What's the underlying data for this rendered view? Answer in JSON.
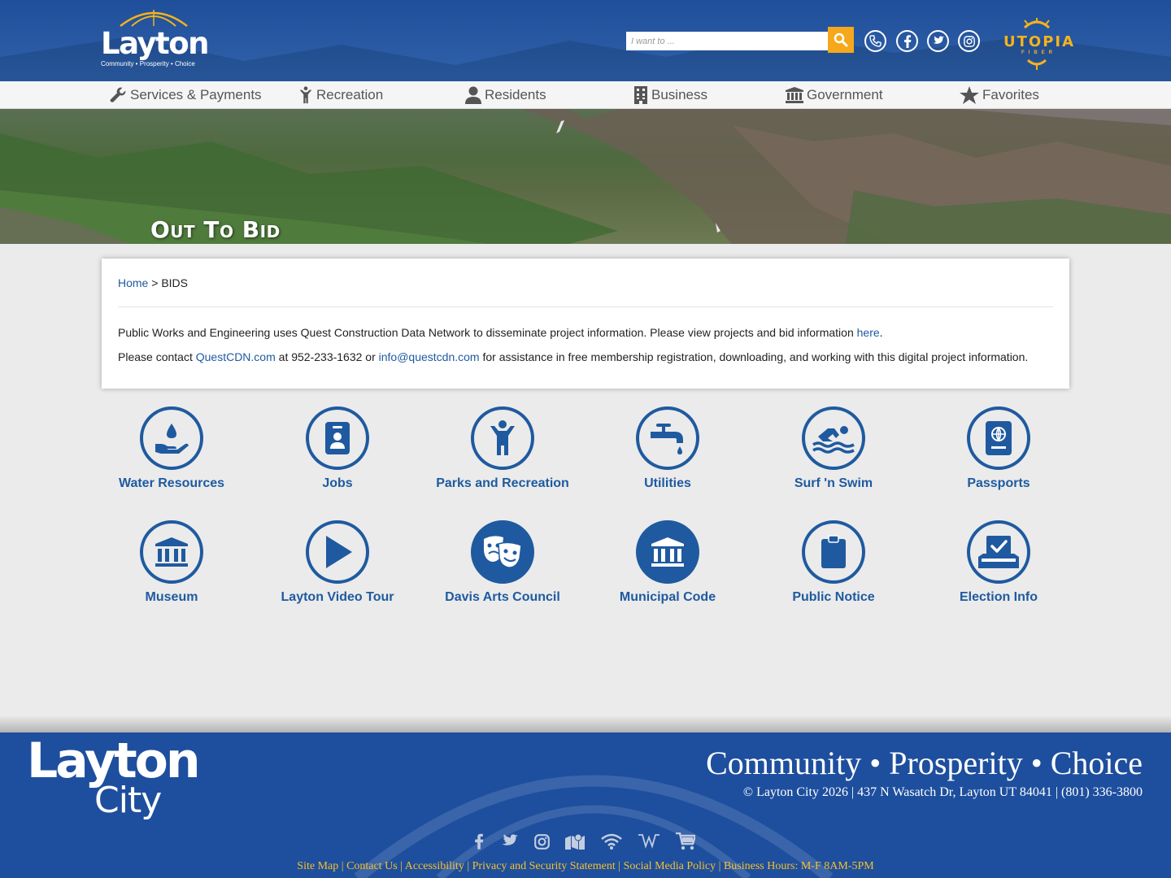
{
  "header": {
    "logo_word": "Layton",
    "logo_tagline": "Community • Prosperity • Choice",
    "search_placeholder": "I want to ...",
    "utopia_word": "UTOPIA",
    "utopia_sub": "FIBER"
  },
  "nav": {
    "items": [
      {
        "label": "Services & Payments",
        "icon": "wrench-icon"
      },
      {
        "label": "Recreation",
        "icon": "person-icon"
      },
      {
        "label": "Residents",
        "icon": "user-icon"
      },
      {
        "label": "Business",
        "icon": "building-icon"
      },
      {
        "label": "Government",
        "icon": "columns-icon"
      },
      {
        "label": "Favorites",
        "icon": "star-icon"
      }
    ]
  },
  "hero": {
    "title": "Out To Bid"
  },
  "breadcrumb": {
    "home": "Home",
    "separator": ">",
    "current": "BIDS"
  },
  "content": {
    "p1_text": "Public Works and Engineering uses Quest Construction Data Network to disseminate project information. Please view projects and bid information ",
    "p1_link": "here",
    "p1_end": ".",
    "p2_start": "Please contact ",
    "p2_link1": "QuestCDN.com",
    "p2_mid": " at 952-233-1632 or ",
    "p2_link2": "info@questcdn.com",
    "p2_end": " for assistance in free membership registration, downloading, and working with this digital project information."
  },
  "tiles": [
    {
      "label": "Water Resources",
      "icon": "water-hand-icon"
    },
    {
      "label": "Jobs",
      "icon": "id-badge-icon"
    },
    {
      "label": "Parks and Recreation",
      "icon": "child-icon"
    },
    {
      "label": "Utilities",
      "icon": "faucet-icon"
    },
    {
      "label": "Surf 'n Swim",
      "icon": "swimmer-icon"
    },
    {
      "label": "Passports",
      "icon": "passport-icon"
    },
    {
      "label": "Museum",
      "icon": "museum-icon"
    },
    {
      "label": "Layton Video Tour",
      "icon": "play-icon"
    },
    {
      "label": "Davis Arts Council",
      "icon": "theater-masks-icon"
    },
    {
      "label": "Municipal Code",
      "icon": "courthouse-icon"
    },
    {
      "label": "Public Notice",
      "icon": "clipboard-icon"
    },
    {
      "label": "Election Info",
      "icon": "ballot-box-icon"
    }
  ],
  "footer": {
    "logo_line1": "Layton",
    "logo_line2": "City",
    "tagline": "Community • Prosperity • Choice",
    "address": "© Layton City 2026 | 437 N Wasatch Dr, Layton UT 84041 | (801) 336-3800",
    "links": [
      "Site Map",
      "Contact Us",
      "Accessibility",
      "Privacy and Security Statement",
      "Social Media Policy",
      "Business Hours: M-F 8AM-5PM"
    ],
    "socials": [
      "facebook-icon",
      "twitter-icon",
      "instagram-icon",
      "map-icon",
      "wifi-icon",
      "wikipedia-icon",
      "cart-icon"
    ]
  },
  "colors": {
    "brand_blue": "#1f5aa0",
    "header_blue": "#2a5aa3",
    "accent_orange": "#f6a81c",
    "footer_blue": "#1e4f9e",
    "footer_link_gold": "#f6c02a"
  }
}
